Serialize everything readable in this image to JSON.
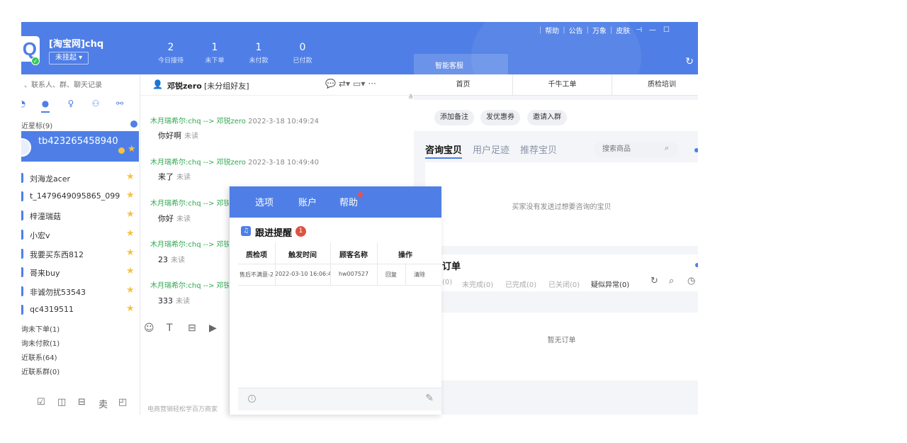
{
  "header": {
    "shop_name": "[淘宝网]chq",
    "status": "未挂起 ▾",
    "stats": [
      {
        "num": "2",
        "label": "今日接待"
      },
      {
        "num": "1",
        "label": "未下单"
      },
      {
        "num": "1",
        "label": "未付款"
      },
      {
        "num": "0",
        "label": "已付款"
      }
    ],
    "ai_tab": "智能客服",
    "links": [
      "帮助",
      "公告",
      "万象",
      "皮肤"
    ]
  },
  "sidebar": {
    "search_placeholder": "、联系人、群、聊天记录",
    "recent_starred": "近星标(9)",
    "active_contact": "tb423265458940",
    "contacts": [
      "刘海龙acer",
      "t_1479649095865_099",
      "梓潼瑞菇",
      "小宏v",
      "我要买东西812",
      "哥来buy",
      "非诚勿扰53543",
      "qc4319511"
    ],
    "categories": [
      "询未下单(1)",
      "询未付款(1)",
      "近联系(64)",
      "近联系群(0)"
    ],
    "bottom_icons": [
      "☑",
      "◫",
      "⊟",
      "卖",
      "◰"
    ]
  },
  "chat": {
    "contact_name": "邓锐zero",
    "contact_tag": "[未分组好友]",
    "messages": [
      {
        "meta": "木月瑞希尔:chq --> 邓锐zero",
        "time": "2022-3-18 10:49:24",
        "text": "你好啊",
        "status": "未读"
      },
      {
        "meta": "木月瑞希尔:chq --> 邓锐zero",
        "time": "2022-3-18 10:49:40",
        "text": "来了",
        "status": "未读"
      },
      {
        "meta": "木月瑞希尔:chq --> 邓锐",
        "time": "",
        "text": "你好",
        "status": "未读"
      },
      {
        "meta": "木月瑞希尔:chq --> 邓锐",
        "time": "",
        "text": "23",
        "status": "未读"
      },
      {
        "meta": "木月瑞希尔:chq --> 邓锐",
        "time": "",
        "text": "333",
        "status": "未读"
      }
    ],
    "footer": "电商营销轻松学百万商家"
  },
  "right": {
    "tabs": [
      "首页",
      "千牛工单",
      "质检培训"
    ],
    "actions": [
      "添加备注",
      "发优惠券",
      "邀请入群"
    ],
    "goods_tabs": [
      "咨询宝贝",
      "用户足迹",
      "推荐宝贝"
    ],
    "goods_search_placeholder": "搜索商品",
    "goods_empty": "买家没有发送过想要咨询的宝贝",
    "orders_title": "订单",
    "order_tabs": [
      "(0)",
      "未完成(0)",
      "已完成(0)",
      "已关闭(0)",
      "疑似异常(0)"
    ],
    "orders_empty": "暂无订单"
  },
  "dialog": {
    "menu": [
      "选项",
      "账户",
      "帮助"
    ],
    "title": "跟进提醒",
    "badge": "1",
    "columns": [
      "质检项",
      "触发时间",
      "顾客名称",
      "操作"
    ],
    "rows": [
      {
        "item": "售后不满意-2",
        "time": "2022-03-10 16:06:41",
        "customer": "hw007527",
        "action1": "回复",
        "action2": "清除"
      }
    ]
  },
  "colors": {
    "primary": "#4f7fe6",
    "star": "#f5c242",
    "green_meta": "#2fa84f",
    "alert": "#e0513f"
  }
}
